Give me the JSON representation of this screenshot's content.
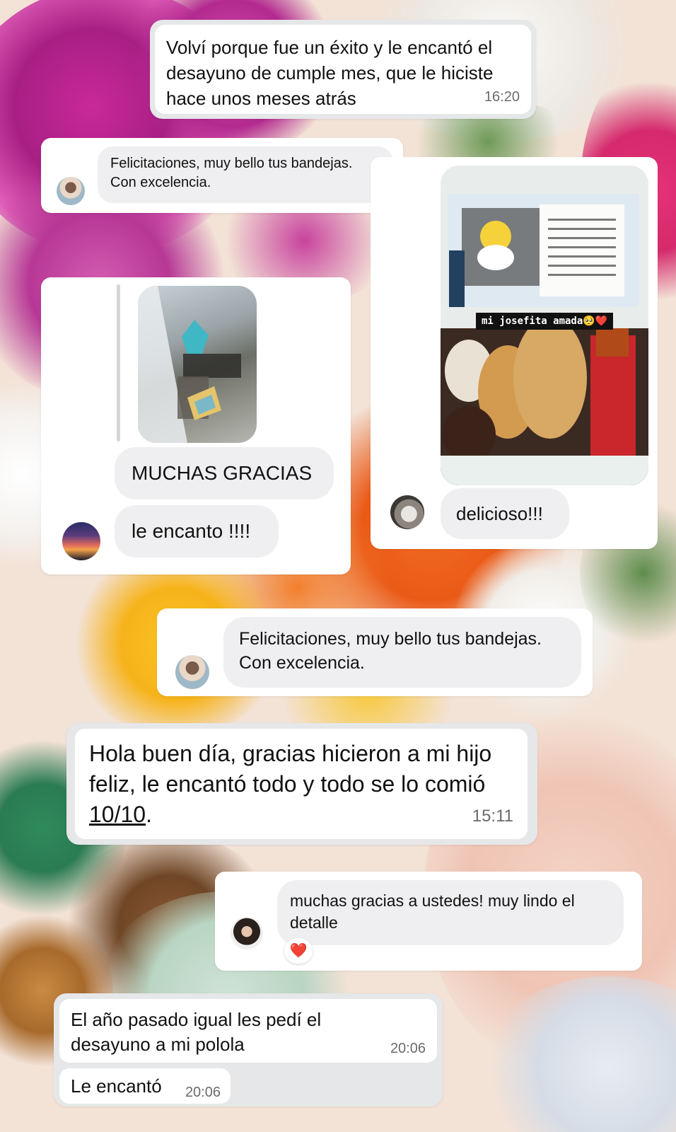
{
  "messages": {
    "m1": {
      "text": "Volví porque fue un éxito y le encantó el desayuno de cumple mes, que le hiciste hace unos meses atrás",
      "time": "16:20"
    },
    "m2": {
      "text": "Felicitaciones, muy bello tus bandejas. Con excelencia."
    },
    "m3": {
      "line1": "MUCHAS GRACIAS",
      "line2": "le encanto !!!!"
    },
    "m4": {
      "story_caption": "mi josefita amada🥺❤️",
      "reply": "delicioso!!!"
    },
    "m5": {
      "text": "Felicitaciones, muy bello tus bandejas. Con excelencia."
    },
    "m6": {
      "text_before": "Hola buen día, gracias hicieron a mi hijo feliz, le encantó todo y todo se lo comió ",
      "score": "10/10",
      "text_after": ".",
      "time": "15:11"
    },
    "m7": {
      "text": "muchas gracias a ustedes! muy lindo el detalle",
      "reaction": "❤️"
    },
    "m8": {
      "text": "El año pasado igual les pedí el desayuno a mi polola",
      "time": "20:06"
    },
    "m9": {
      "text": "Le encantó",
      "time": "20:06"
    }
  },
  "icons": {
    "avatar1": "boy-avatar-icon",
    "avatar2": "sunset-avatar-icon",
    "avatar3": "dog-avatar-icon",
    "avatar4": "boy-avatar-icon",
    "avatar5": "woman-avatar-icon"
  }
}
